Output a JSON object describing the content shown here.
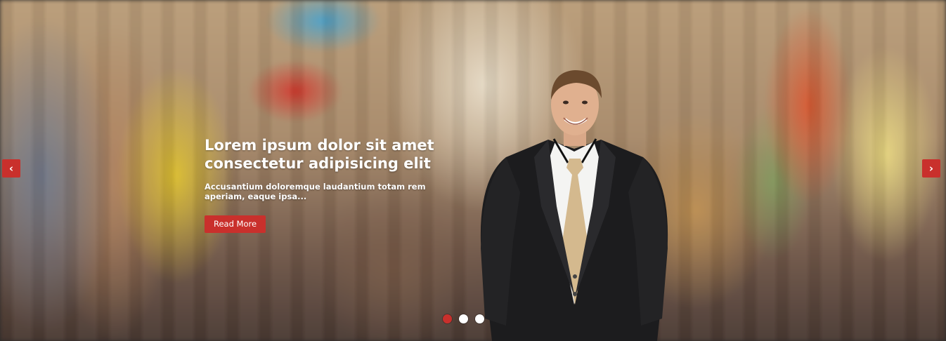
{
  "slider": {
    "prev_icon": "chevron-left-icon",
    "next_icon": "chevron-right-icon",
    "prev_glyph": "‹",
    "next_glyph": "›",
    "active_slide": 1,
    "slide_count": 3
  },
  "slide": {
    "heading_line1": "Lorem ipsum dolor sit amet",
    "heading_line2": "consectetur adipisicing elit",
    "subtext": "Accusantium doloremque laudantium totam rem aperiam, eaque ipsa...",
    "button_label": "Read More"
  },
  "colors": {
    "accent": "#c9302c",
    "text": "#ffffff"
  }
}
